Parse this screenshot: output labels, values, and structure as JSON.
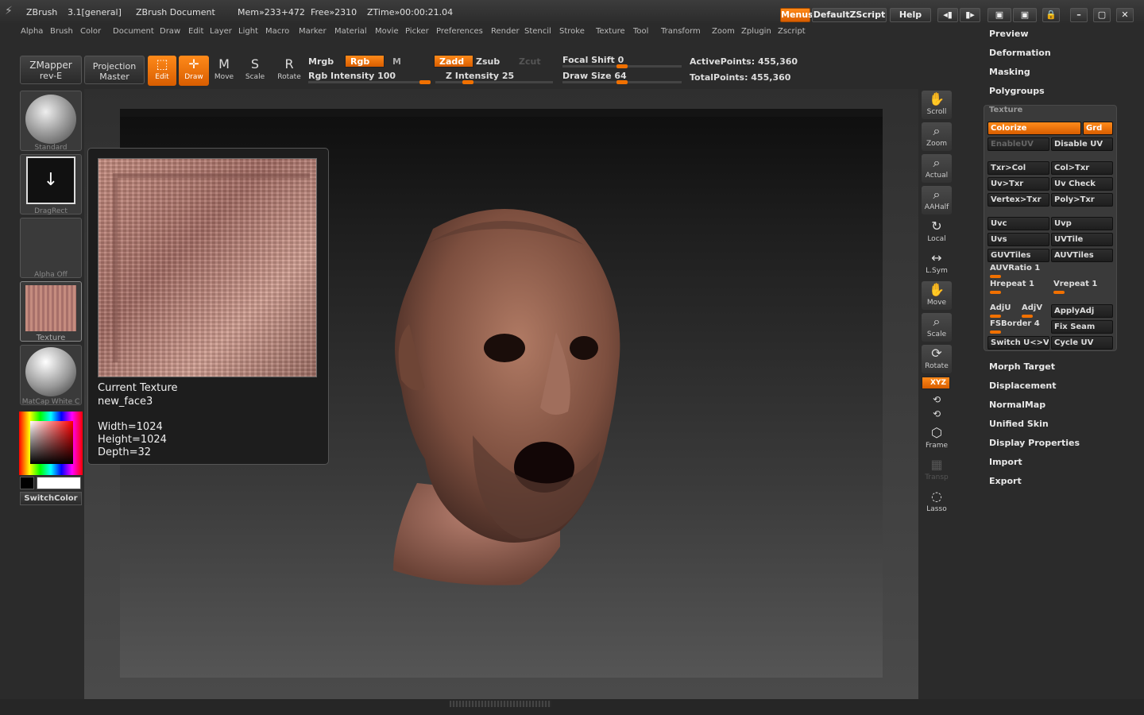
{
  "title": {
    "app": "ZBrush",
    "version": "3.1[general]",
    "document": "ZBrush Document",
    "mem": "Mem»233+472",
    "free": "Free»2310",
    "ztime": "ZTime»00:00:21.04"
  },
  "top_buttons": {
    "menus": "Menus",
    "script": "DefaultZScript",
    "help": "Help"
  },
  "menus": [
    "Alpha",
    "Brush",
    "Color",
    "Document",
    "Draw",
    "Edit",
    "Layer",
    "Light",
    "Macro",
    "Marker",
    "Material",
    "Movie",
    "Picker",
    "Preferences",
    "Render",
    "Stencil",
    "Stroke",
    "Texture",
    "Tool",
    "Transform",
    "Zoom",
    "Zplugin",
    "Zscript"
  ],
  "shelf": {
    "zmapper": "ZMapper",
    "zmapper_sub": "rev-E",
    "projection": "Projection",
    "projection_sub": "Master",
    "edit": "Edit",
    "draw": "Draw",
    "move": "Move",
    "scale": "Scale",
    "rotate": "Rotate",
    "mrgb": "Mrgb",
    "rgb": "Rgb",
    "m": "M",
    "rgb_intensity": "Rgb Intensity 100",
    "zadd": "Zadd",
    "zsub": "Zsub",
    "zcut": "Zcut",
    "z_intensity": "Z Intensity 25",
    "focal_shift": "Focal Shift 0",
    "draw_size": "Draw Size 64",
    "active_points": "ActivePoints: 455,360",
    "total_points": "TotalPoints: 455,360"
  },
  "left": {
    "brush": "Standard",
    "stroke": "DragRect",
    "alpha": "Alpha Off",
    "texture": "Texture",
    "material": "MatCap White C",
    "switch": "SwitchColor"
  },
  "popup": {
    "title": "Current Texture",
    "name": "new_face3",
    "width": "Width=1024",
    "height": "Height=1024",
    "depth": "Depth=32"
  },
  "right_tray": [
    "Scroll",
    "Zoom",
    "Actual",
    "AAHalf",
    "Local",
    "L.Sym",
    "Move",
    "Scale",
    "Rotate",
    "Frame",
    "Transp",
    "Lasso"
  ],
  "xyz": "XYZ",
  "rpanel": {
    "top": [
      "Preview",
      "Deformation",
      "Masking",
      "Polygroups"
    ],
    "texture_title": "Texture",
    "colorize": "Colorize",
    "grd": "Grd",
    "enableuv": "EnableUV",
    "disableuv": "Disable UV",
    "txr_col": "Txr>Col",
    "col_txr": "Col>Txr",
    "uv_txr": "Uv>Txr",
    "uv_check": "Uv Check",
    "vertex_txr": "Vertex>Txr",
    "poly_txr": "Poly>Txr",
    "uvc": "Uvc",
    "uvp": "Uvp",
    "uvs": "Uvs",
    "uvtile": "UVTile",
    "guvtiles": "GUVTiles",
    "auvtiles": "AUVTiles",
    "auvratio": "AUVRatio 1",
    "hrepeat": "Hrepeat 1",
    "vrepeat": "Vrepeat 1",
    "adju": "AdjU",
    "adjv": "AdjV",
    "applyadj": "ApplyAdj",
    "fsborder": "FSBorder 4",
    "fixseam": "Fix Seam",
    "switchuv": "Switch U<>V",
    "cycleuv": "Cycle UV",
    "bottom": [
      "Morph Target",
      "Displacement",
      "NormalMap",
      "Unified Skin",
      "Display Properties",
      "Import",
      "Export"
    ]
  },
  "colors": {
    "accent": "#f07000",
    "panel": "#2b2b2b"
  }
}
